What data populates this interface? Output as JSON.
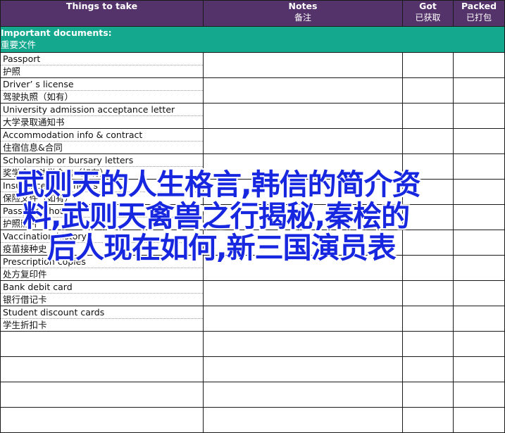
{
  "header": {
    "things": "Things to take",
    "notes": "Notes",
    "notes_cn": "备注",
    "got": "Got",
    "got_cn": "已获取",
    "packed": "Packed",
    "packed_cn": "已打包"
  },
  "section": {
    "title": "Important documents:",
    "title_cn": "重要文件"
  },
  "items": [
    {
      "en": "Passport",
      "cn": "护照"
    },
    {
      "en": "Driver’ s license",
      "cn": "驾驶执照（如有）"
    },
    {
      "en": "University admission acceptance letter",
      "cn": "大学录取通知书"
    },
    {
      "en": "Accommodation info & contract",
      "cn": "住宿信息&合同"
    },
    {
      "en": "Scholarship or bursary letters",
      "cn": "奖学金或助学金信（如有）"
    },
    {
      "en": "Insurance documents",
      "cn": "保险文件（如有）"
    },
    {
      "en": "Passport photos",
      "cn": "护照照片"
    },
    {
      "en": "Vaccination history",
      "cn": "疫苗接种史"
    },
    {
      "en": "Prescription copies",
      "cn": "处方复印件"
    },
    {
      "en": "Bank debit card",
      "cn": "银行借记卡"
    },
    {
      "en": "Student discount cards",
      "cn": "学生折扣卡"
    }
  ],
  "overlay": {
    "line1": "武则天的人生格言,韩信的简介资",
    "line2": "料,武则天禽兽之行揭秘,秦桧的",
    "line3": "后人现在如何,新三国演员表"
  }
}
